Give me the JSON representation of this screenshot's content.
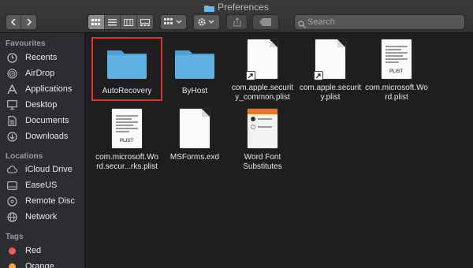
{
  "window": {
    "title": "Preferences"
  },
  "toolbar": {
    "search_placeholder": "Search"
  },
  "sidebar": {
    "favourites_label": "Favourites",
    "favourites": [
      {
        "label": "Recents",
        "icon": "clock-icon"
      },
      {
        "label": "AirDrop",
        "icon": "airdrop-icon"
      },
      {
        "label": "Applications",
        "icon": "applications-icon"
      },
      {
        "label": "Desktop",
        "icon": "desktop-icon"
      },
      {
        "label": "Documents",
        "icon": "documents-icon"
      },
      {
        "label": "Downloads",
        "icon": "downloads-icon"
      }
    ],
    "locations_label": "Locations",
    "locations": [
      {
        "label": "iCloud Drive",
        "icon": "cloud-icon"
      },
      {
        "label": "EaseUS",
        "icon": "drive-icon"
      },
      {
        "label": "Remote Disc",
        "icon": "disc-icon"
      },
      {
        "label": "Network",
        "icon": "globe-icon"
      }
    ],
    "tags_label": "Tags",
    "tags": [
      {
        "label": "Red",
        "color": "#f0595a"
      },
      {
        "label": "Orange",
        "color": "#f5a33b"
      }
    ]
  },
  "files": [
    {
      "name": "AutoRecovery",
      "type": "folder",
      "selected": true
    },
    {
      "name": "ByHost",
      "type": "folder"
    },
    {
      "name": "com.apple.security_common.plist",
      "display": "com.apple.securit\ny_common.plist",
      "type": "doc-alias"
    },
    {
      "name": "com.apple.security.plist",
      "display": "com.apple.securit\ny.plist",
      "type": "doc-alias"
    },
    {
      "name": "com.microsoft.Word.plist",
      "display": "com.microsoft.Wo\nrd.plist",
      "type": "plist"
    },
    {
      "name": "com.microsoft.Word.secur...rks.plist",
      "display": "com.microsoft.Wo\nrd.secur...rks.plist",
      "type": "plist"
    },
    {
      "name": "MSForms.exd",
      "display": "MSForms.exd",
      "type": "doc"
    },
    {
      "name": "Word Font Substitutes",
      "display": "Word Font\nSubstitutes",
      "type": "pref"
    }
  ],
  "colors": {
    "selection": "#e03131",
    "folder": "#5fb0e3",
    "accent": "#8c8c8c"
  }
}
